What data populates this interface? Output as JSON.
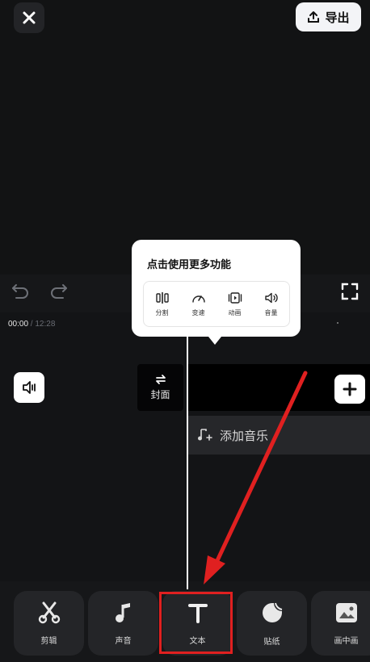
{
  "header": {
    "close_icon": "close-icon",
    "export_label": "导出",
    "export_icon": "upload-icon"
  },
  "controls": {
    "undo_icon": "undo-icon",
    "redo_icon": "redo-icon",
    "fullscreen_icon": "fullscreen-icon"
  },
  "timeline": {
    "current_time": "00:00",
    "separator": " / ",
    "total_time": "12:28",
    "cover_label": "封面",
    "add_music_label": "添加音乐"
  },
  "popup": {
    "title": "点击使用更多功能",
    "items": [
      {
        "label": "分割",
        "icon": "split-icon"
      },
      {
        "label": "变速",
        "icon": "speed-icon"
      },
      {
        "label": "动画",
        "icon": "animation-icon"
      },
      {
        "label": "音量",
        "icon": "volume-icon"
      }
    ]
  },
  "toolbar": {
    "items": [
      {
        "label": "剪辑",
        "icon": "scissors-icon"
      },
      {
        "label": "声音",
        "icon": "music-note-icon"
      },
      {
        "label": "文本",
        "icon": "text-icon"
      },
      {
        "label": "贴纸",
        "icon": "sticker-icon"
      },
      {
        "label": "画中画",
        "icon": "picture-in-picture-icon"
      }
    ]
  },
  "colors": {
    "background": "#161719",
    "highlight": "#e02020",
    "arrow": "#e02020"
  }
}
